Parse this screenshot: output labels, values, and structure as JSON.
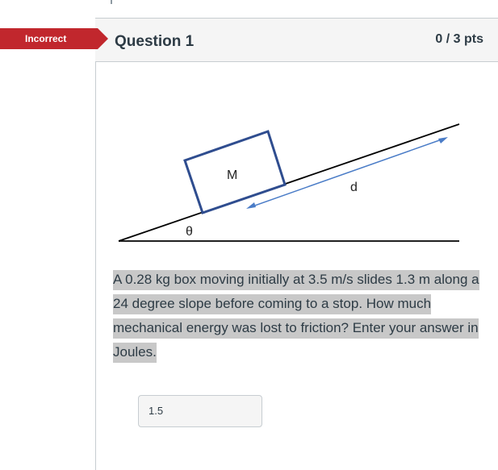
{
  "status": {
    "label": "Incorrect",
    "color": "#c1272d"
  },
  "question": {
    "title": "Question 1",
    "points": "0 / 3 pts",
    "text": "A 0.28 kg box moving initially at 3.5 m/s slides 1.3 m along a 24 degree slope before coming to a stop. How much mechanical energy was lost to friction? Enter your answer in Joules.",
    "answer": "1.5"
  },
  "diagram": {
    "mass_label": "M",
    "distance_label": "d",
    "angle_label": "θ",
    "line_color": "#000000",
    "box_color": "#2f4d8f",
    "arrow_color": "#4a7cc7"
  }
}
